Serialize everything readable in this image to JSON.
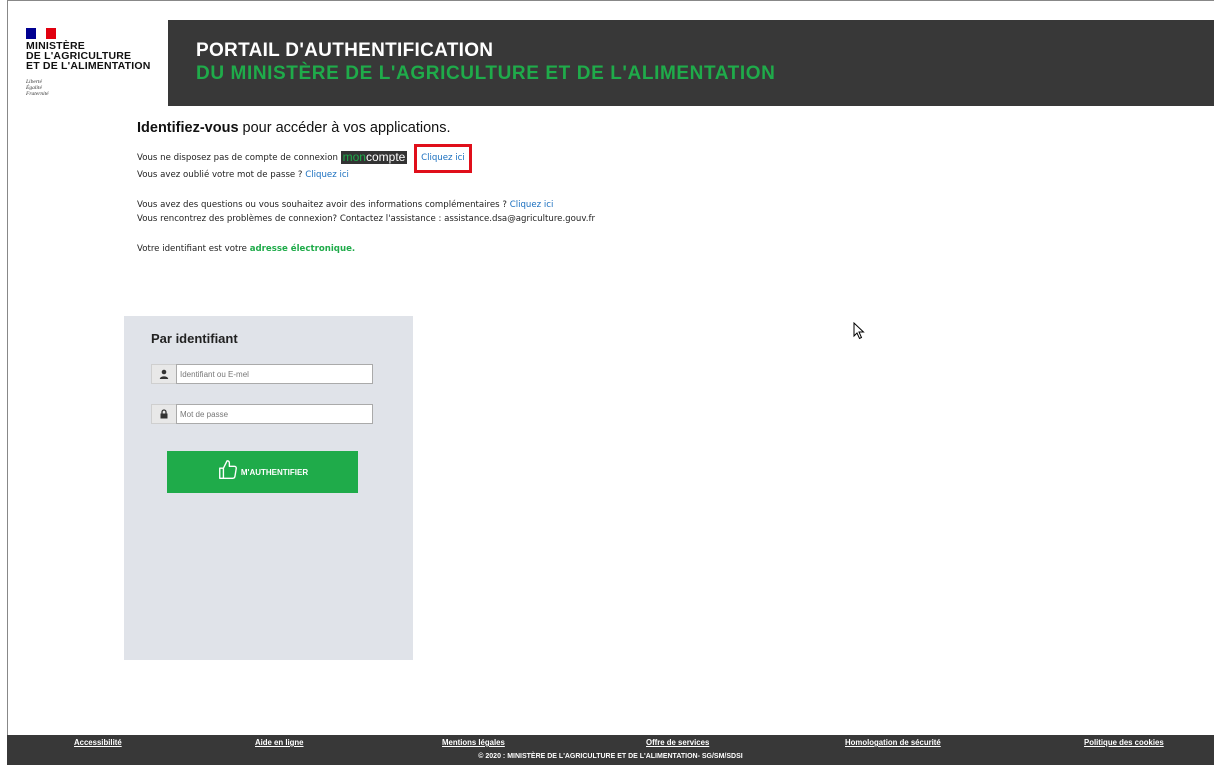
{
  "header": {
    "ministry_lines": [
      "MINISTÈRE",
      "DE L'AGRICULTURE",
      "ET DE L'ALIMENTATION"
    ],
    "motto_lines": [
      "Liberté",
      "Égalité",
      "Fraternité"
    ],
    "title": "PORTAIL D'AUTHENTIFICATION",
    "subtitle": "DU MINISTÈRE DE L'AGRICULTURE ET DE L'ALIMENTATION",
    "colors": {
      "banner": "#383838",
      "accent": "#1fab4a"
    }
  },
  "intro": {
    "heading_bold": "Identifiez-vous",
    "heading_rest": " pour accéder à vos applications.",
    "no_account_text": "Vous ne disposez pas de compte de connexion",
    "moncompte_mon": "mon",
    "moncompte_compte": "compte",
    "no_account_link": "Cliquez ici",
    "forgot_text": "Vous avez oublié votre mot de passe ?",
    "forgot_link": "Cliquez ici",
    "questions_text": "Vous avez des questions ou vous souhaitez avoir des informations complémentaires ?",
    "questions_link": "Cliquez ici",
    "problems_text": "Vous rencontrez des problèmes de connexion? Contactez l'assistance : assistance.dsa@agriculture.gouv.fr",
    "identifier_text": "Votre identifiant est votre",
    "identifier_highlight": "adresse électronique."
  },
  "login": {
    "title": "Par identifiant",
    "username_placeholder": "Identifiant ou E-mel",
    "password_placeholder": "Mot de passe",
    "submit_label": "M'AUTHENTIFIER"
  },
  "footer": {
    "links": [
      "Accessibilité",
      "Aide en ligne",
      "Mentions légales",
      "Offre de services",
      "Homologation de sécurité",
      "Politique des cookies"
    ],
    "copyright": "© 2020 : MINISTÈRE DE L'AGRICULTURE ET DE L'ALIMENTATION- SG/SM/SDSI"
  }
}
